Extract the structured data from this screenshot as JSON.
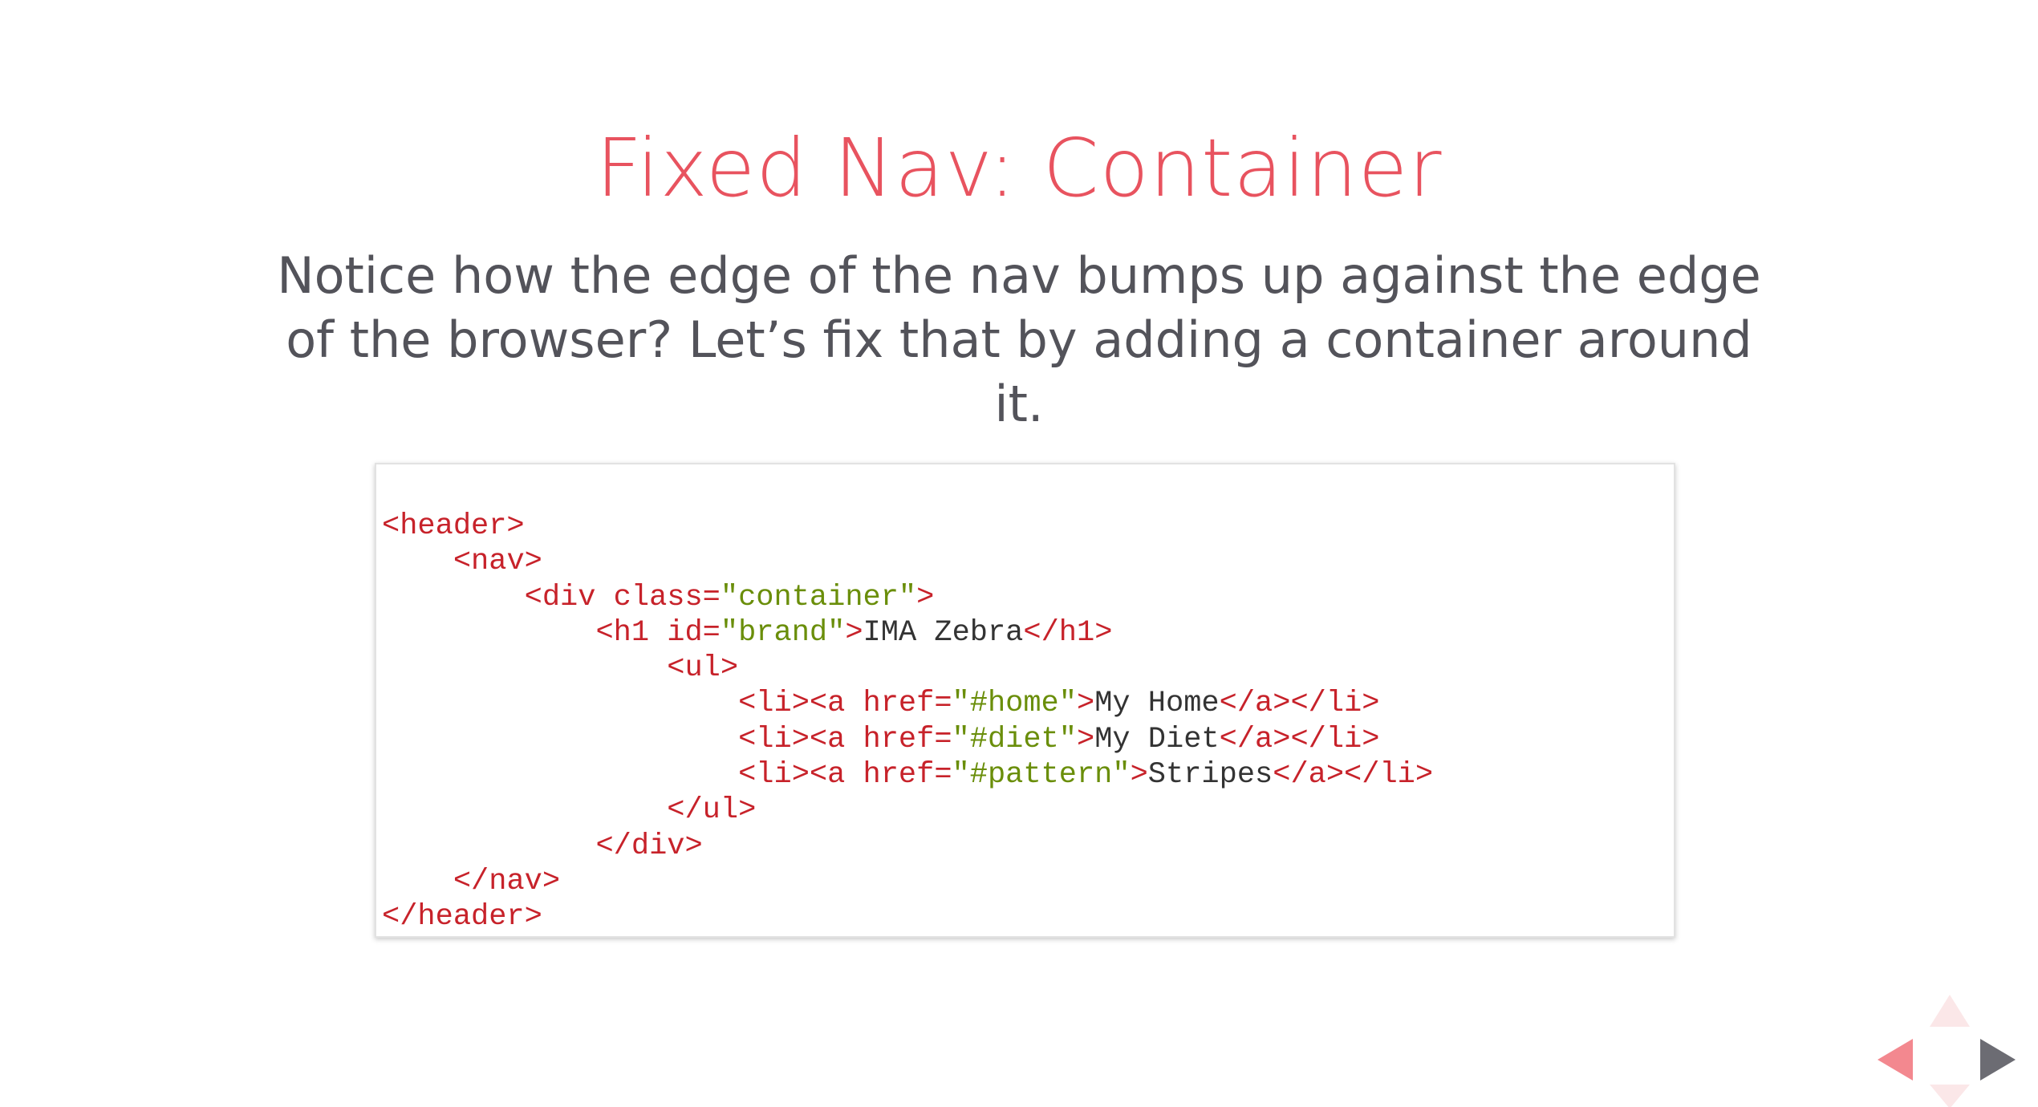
{
  "slide": {
    "title": "Fixed Nav: Container",
    "subtitle": "Notice how the edge of the nav bumps up against the edge of the browser? Let’s fix that by adding a container around it."
  },
  "code": {
    "lines": [
      [
        [
          "tag",
          "<header>"
        ]
      ],
      [
        [
          "txt",
          "    "
        ],
        [
          "tag",
          "<nav>"
        ]
      ],
      [
        [
          "txt",
          "        "
        ],
        [
          "tag",
          "<div class="
        ],
        [
          "str",
          "\"container\""
        ],
        [
          "tag",
          ">"
        ]
      ],
      [
        [
          "txt",
          "            "
        ],
        [
          "tag",
          "<h1 id="
        ],
        [
          "str",
          "\"brand\""
        ],
        [
          "tag",
          ">"
        ],
        [
          "txt",
          "IMA Zebra"
        ],
        [
          "tag",
          "</h1>"
        ]
      ],
      [
        [
          "txt",
          "                "
        ],
        [
          "tag",
          "<ul>"
        ]
      ],
      [
        [
          "txt",
          "                    "
        ],
        [
          "tag",
          "<li><a href="
        ],
        [
          "str",
          "\"#home\""
        ],
        [
          "tag",
          ">"
        ],
        [
          "txt",
          "My Home"
        ],
        [
          "tag",
          "</a></li>"
        ]
      ],
      [
        [
          "txt",
          "                    "
        ],
        [
          "tag",
          "<li><a href="
        ],
        [
          "str",
          "\"#diet\""
        ],
        [
          "tag",
          ">"
        ],
        [
          "txt",
          "My Diet"
        ],
        [
          "tag",
          "</a></li>"
        ]
      ],
      [
        [
          "txt",
          "                    "
        ],
        [
          "tag",
          "<li><a href="
        ],
        [
          "str",
          "\"#pattern\""
        ],
        [
          "tag",
          ">"
        ],
        [
          "txt",
          "Stripes"
        ],
        [
          "tag",
          "</a></li>"
        ]
      ],
      [
        [
          "txt",
          "                "
        ],
        [
          "tag",
          "</ul>"
        ]
      ],
      [
        [
          "txt",
          "            "
        ],
        [
          "tag",
          "</div>"
        ]
      ],
      [
        [
          "txt",
          "    "
        ],
        [
          "tag",
          "</nav>"
        ]
      ],
      [
        [
          "tag",
          "</header>"
        ]
      ]
    ]
  },
  "navigation": {
    "up_icon": "triangle-up-icon",
    "down_icon": "triangle-down-icon",
    "prev_icon": "triangle-left-icon",
    "next_icon": "triangle-right-icon"
  },
  "colors": {
    "title": "#e8535f",
    "subtitle": "#53535a",
    "code_tag": "#c7222a",
    "code_string": "#6a8e0a",
    "code_text": "#333333",
    "nav_prev": "#f3888f",
    "nav_next": "#6c6c73",
    "nav_disabled": "#fbe7e8"
  }
}
